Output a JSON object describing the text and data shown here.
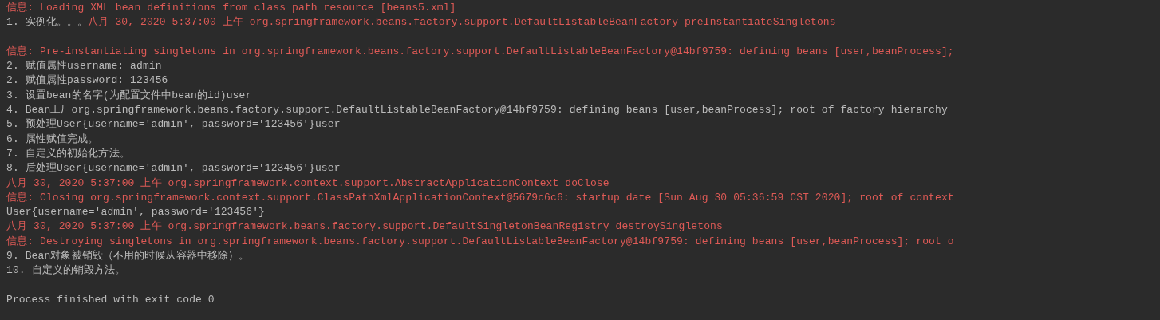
{
  "console": {
    "lines": [
      {
        "kind": "text",
        "segments": [
          {
            "kind": "stderr",
            "text": "信息: Loading XML bean definitions from class path resource [beans5.xml]"
          }
        ]
      },
      {
        "kind": "text",
        "segments": [
          {
            "kind": "stdout",
            "text": "1. 实例化。。。"
          },
          {
            "kind": "stderr",
            "text": "八月 30, 2020 5:37:00 上午 org.springframework.beans.factory.support.DefaultListableBeanFactory preInstantiateSingletons"
          }
        ]
      },
      {
        "kind": "blank"
      },
      {
        "kind": "text",
        "segments": [
          {
            "kind": "stderr",
            "text": "信息: Pre-instantiating singletons in org.springframework.beans.factory.support.DefaultListableBeanFactory@14bf9759: defining beans [user,beanProcess];"
          }
        ]
      },
      {
        "kind": "text",
        "segments": [
          {
            "kind": "stdout",
            "text": "2. 赋值属性username: admin"
          }
        ]
      },
      {
        "kind": "text",
        "segments": [
          {
            "kind": "stdout",
            "text": "2. 赋值属性password: 123456"
          }
        ]
      },
      {
        "kind": "text",
        "segments": [
          {
            "kind": "stdout",
            "text": "3. 设置bean的名字(为配置文件中bean的id)user"
          }
        ]
      },
      {
        "kind": "text",
        "segments": [
          {
            "kind": "stdout",
            "text": "4. Bean工厂org.springframework.beans.factory.support.DefaultListableBeanFactory@14bf9759: defining beans [user,beanProcess]; root of factory hierarchy"
          }
        ]
      },
      {
        "kind": "text",
        "segments": [
          {
            "kind": "stdout",
            "text": "5. 预处理User{username='admin', password='123456'}user"
          }
        ]
      },
      {
        "kind": "text",
        "segments": [
          {
            "kind": "stdout",
            "text": "6. 属性赋值完成。"
          }
        ]
      },
      {
        "kind": "text",
        "segments": [
          {
            "kind": "stdout",
            "text": "7. 自定义的初始化方法。"
          }
        ]
      },
      {
        "kind": "text",
        "segments": [
          {
            "kind": "stdout",
            "text": "8. 后处理User{username='admin', password='123456'}user"
          }
        ]
      },
      {
        "kind": "text",
        "segments": [
          {
            "kind": "stderr",
            "text": "八月 30, 2020 5:37:00 上午 org.springframework.context.support.AbstractApplicationContext doClose"
          }
        ]
      },
      {
        "kind": "text",
        "segments": [
          {
            "kind": "stderr",
            "text": "信息: Closing org.springframework.context.support.ClassPathXmlApplicationContext@5679c6c6: startup date [Sun Aug 30 05:36:59 CST 2020]; root of context"
          }
        ]
      },
      {
        "kind": "text",
        "segments": [
          {
            "kind": "stdout",
            "text": "User{username='admin', password='123456'}"
          }
        ]
      },
      {
        "kind": "text",
        "segments": [
          {
            "kind": "stderr",
            "text": "八月 30, 2020 5:37:00 上午 org.springframework.beans.factory.support.DefaultSingletonBeanRegistry destroySingletons"
          }
        ]
      },
      {
        "kind": "text",
        "segments": [
          {
            "kind": "stderr",
            "text": "信息: Destroying singletons in org.springframework.beans.factory.support.DefaultListableBeanFactory@14bf9759: defining beans [user,beanProcess]; root o"
          }
        ]
      },
      {
        "kind": "text",
        "segments": [
          {
            "kind": "stdout",
            "text": "9. Bean对象被销毁（不用的时候从容器中移除）。"
          }
        ]
      },
      {
        "kind": "text",
        "segments": [
          {
            "kind": "stdout",
            "text": "10. 自定义的销毁方法。"
          }
        ]
      },
      {
        "kind": "blank"
      },
      {
        "kind": "text",
        "segments": [
          {
            "kind": "stdout",
            "text": "Process finished with exit code 0"
          }
        ]
      }
    ]
  }
}
